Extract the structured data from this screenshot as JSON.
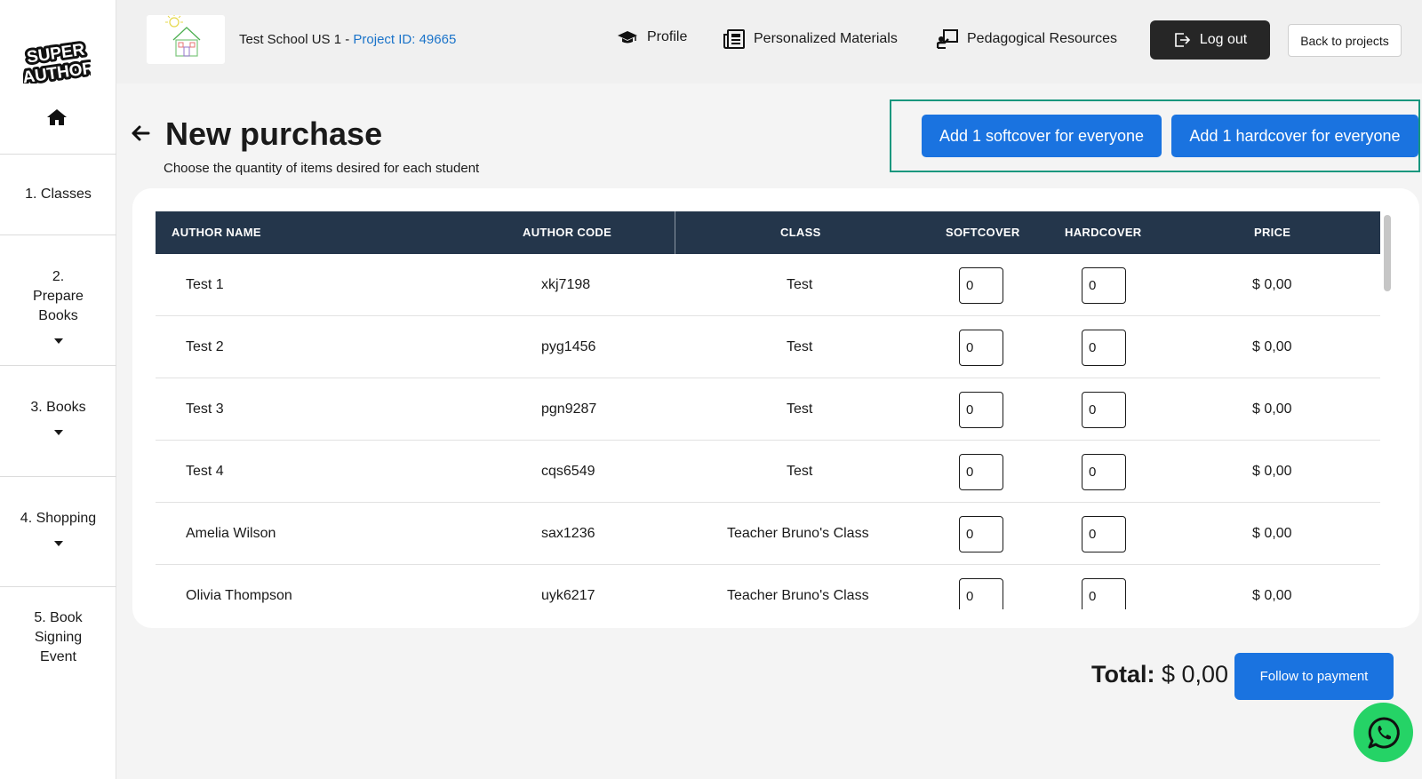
{
  "sidebar": {
    "logo_text": "SUPER AUTHOR",
    "home_icon": "home-icon",
    "items": [
      {
        "label": "1. Classes",
        "has_caret": false
      },
      {
        "label": "2. Prepare Books",
        "has_caret": true
      },
      {
        "label": "3. Books",
        "has_caret": true
      },
      {
        "label": "4. Shopping",
        "has_caret": true
      },
      {
        "label": "5. Book Signing Event",
        "has_caret": false
      }
    ]
  },
  "header": {
    "school_name": "Test School US 1 - ",
    "project_id": "Project ID: 49665",
    "nav": [
      {
        "label": "Profile",
        "icon": "graduation-cap-icon"
      },
      {
        "label": "Personalized Materials",
        "icon": "newspaper-icon"
      },
      {
        "label": "Pedagogical Resources",
        "icon": "teacher-board-icon"
      }
    ],
    "logout_label": "Log out",
    "back_label": "Back to projects"
  },
  "page": {
    "title": "New purchase",
    "subtitle": "Choose the quantity of items desired for each student",
    "add_softcover_label": "Add 1 softcover for everyone",
    "add_hardcover_label": "Add 1 hardcover for everyone"
  },
  "table": {
    "columns": [
      "AUTHOR NAME",
      "AUTHOR CODE",
      "CLASS",
      "SOFTCOVER",
      "HARDCOVER",
      "PRICE"
    ],
    "rows": [
      {
        "name": "Test 1",
        "code": "xkj7198",
        "class": "Test",
        "softcover": "0",
        "hardcover": "0",
        "price": "$ 0,00"
      },
      {
        "name": "Test 2",
        "code": "pyg1456",
        "class": "Test",
        "softcover": "0",
        "hardcover": "0",
        "price": "$ 0,00"
      },
      {
        "name": "Test 3",
        "code": "pgn9287",
        "class": "Test",
        "softcover": "0",
        "hardcover": "0",
        "price": "$ 0,00"
      },
      {
        "name": "Test 4",
        "code": "cqs6549",
        "class": "Test",
        "softcover": "0",
        "hardcover": "0",
        "price": "$ 0,00"
      },
      {
        "name": "Amelia Wilson",
        "code": "sax1236",
        "class": "Teacher Bruno's Class",
        "softcover": "0",
        "hardcover": "0",
        "price": "$ 0,00"
      },
      {
        "name": "Olivia Thompson",
        "code": "uyk6217",
        "class": "Teacher Bruno's Class",
        "softcover": "0",
        "hardcover": "0",
        "price": "$ 0,00"
      }
    ]
  },
  "footer": {
    "total_label": "Total:",
    "total_value": "$ 0,00",
    "pay_label": "Follow to payment"
  },
  "colors": {
    "primary_button": "#1a73e0",
    "table_header": "#24364b",
    "highlight_border": "#18977e",
    "project_id_link": "#1a73c9",
    "whatsapp": "#25d366"
  }
}
